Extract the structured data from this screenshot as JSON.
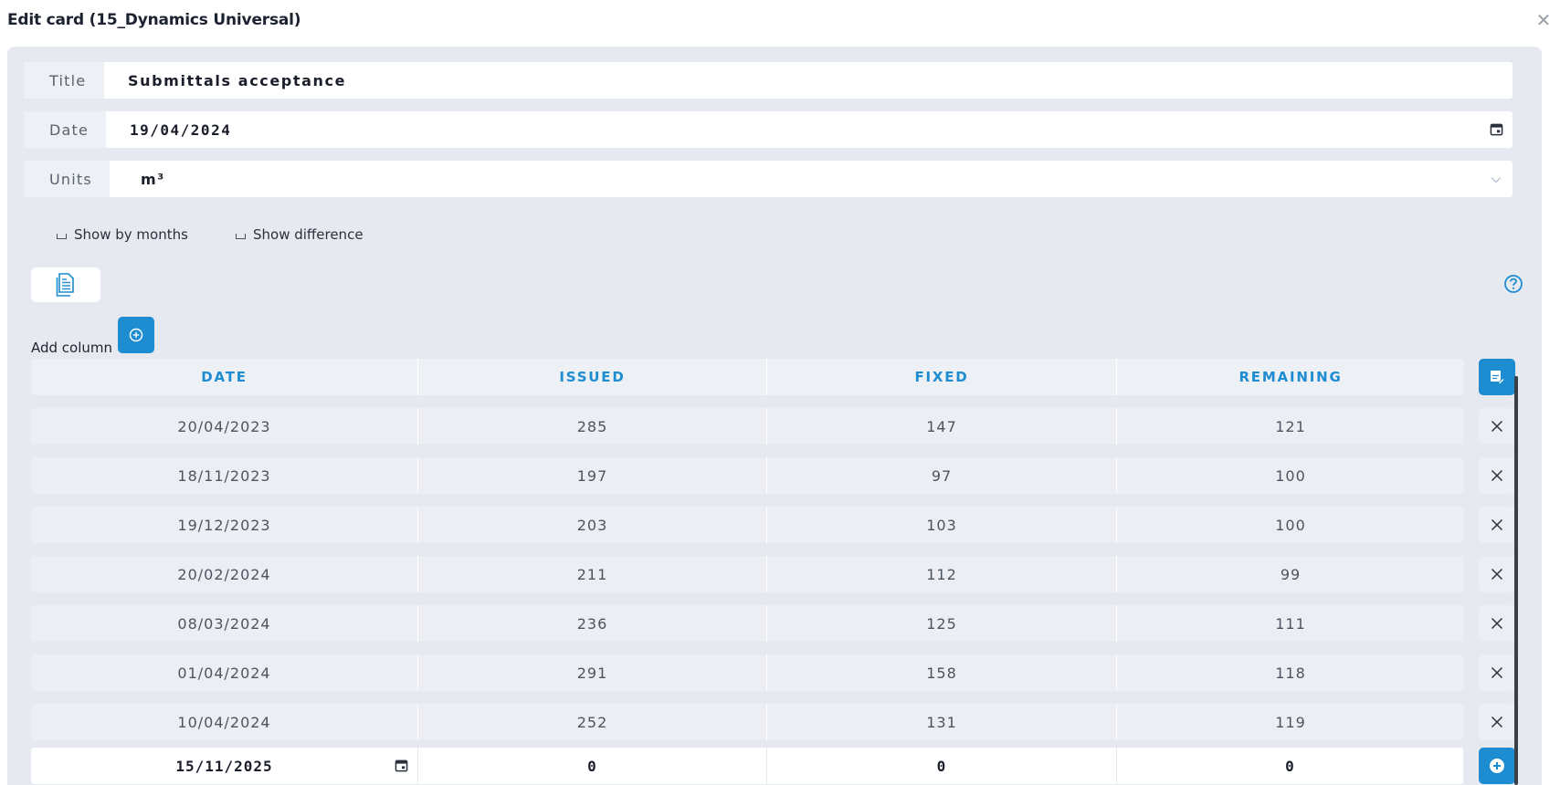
{
  "dialog": {
    "title": "Edit card (15_Dynamics Universal)"
  },
  "fields": {
    "title_label": "Title",
    "title_value": "Submittals acceptance",
    "date_label": "Date",
    "date_value": "19/04/2024",
    "units_label": "Units",
    "units_value": "m³"
  },
  "options": {
    "show_by_months": "Show by months",
    "show_difference": "Show difference",
    "show_by_months_checked": false,
    "show_difference_checked": false
  },
  "add_column_label": "Add column",
  "table": {
    "headers": [
      "DATE",
      "ISSUED",
      "FIXED",
      "REMAINING"
    ],
    "rows": [
      [
        "20/04/2023",
        "285",
        "147",
        "121"
      ],
      [
        "18/11/2023",
        "197",
        "97",
        "100"
      ],
      [
        "19/12/2023",
        "203",
        "103",
        "100"
      ],
      [
        "20/02/2024",
        "211",
        "112",
        "99"
      ],
      [
        "08/03/2024",
        "236",
        "125",
        "111"
      ],
      [
        "01/04/2024",
        "291",
        "158",
        "118"
      ],
      [
        "10/04/2024",
        "252",
        "131",
        "119"
      ]
    ],
    "new_row": [
      "15/11/2025",
      "0",
      "0",
      "0"
    ]
  },
  "colors": {
    "accent": "#1d8cd0",
    "panel": "#e6e9f0"
  },
  "icons": {
    "close": "close-icon",
    "calendar": "calendar-icon",
    "chevron": "chevron-down-icon",
    "report": "report-icon",
    "help": "help-icon",
    "add": "add-circle-icon",
    "table_edit": "table-edit-icon",
    "delete": "delete-icon"
  }
}
